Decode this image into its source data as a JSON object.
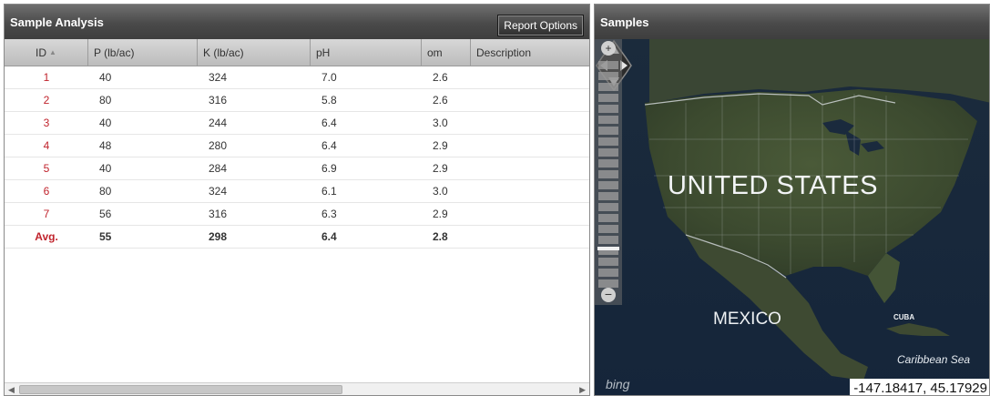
{
  "left_panel": {
    "title": "Sample Analysis",
    "report_button": "Report Options",
    "columns": [
      "ID",
      "P (lb/ac)",
      "K (lb/ac)",
      "pH",
      "om",
      "Description"
    ],
    "sort_icon": "sort-ascending-icon",
    "rows": [
      {
        "id": "1",
        "p": "40",
        "k": "324",
        "ph": "7.0",
        "om": "2.6",
        "desc": ""
      },
      {
        "id": "2",
        "p": "80",
        "k": "316",
        "ph": "5.8",
        "om": "2.6",
        "desc": ""
      },
      {
        "id": "3",
        "p": "40",
        "k": "244",
        "ph": "6.4",
        "om": "3.0",
        "desc": ""
      },
      {
        "id": "4",
        "p": "48",
        "k": "280",
        "ph": "6.4",
        "om": "2.9",
        "desc": ""
      },
      {
        "id": "5",
        "p": "40",
        "k": "284",
        "ph": "6.9",
        "om": "2.9",
        "desc": ""
      },
      {
        "id": "6",
        "p": "80",
        "k": "324",
        "ph": "6.1",
        "om": "3.0",
        "desc": ""
      },
      {
        "id": "7",
        "p": "56",
        "k": "316",
        "ph": "6.3",
        "om": "2.9",
        "desc": ""
      }
    ],
    "avg": {
      "id": "Avg.",
      "p": "55",
      "k": "298",
      "ph": "6.4",
      "om": "2.8",
      "desc": ""
    }
  },
  "right_panel": {
    "title": "Samples",
    "labels": {
      "us": "UNITED STATES",
      "mexico": "MEXICO",
      "cuba": "CUBA",
      "caribbean": "Caribbean Sea"
    },
    "bing": "bing",
    "coordinates": "-147.18417, 45.17929"
  },
  "colors": {
    "id_red": "#c0232c",
    "header_dark": "#4a4a4a",
    "map_land": "#3b4a2e",
    "map_water": "#1a2a3d"
  }
}
